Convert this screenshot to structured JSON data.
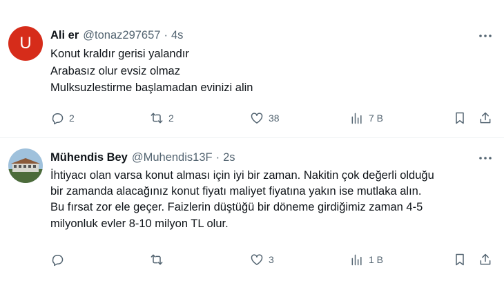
{
  "tweets": [
    {
      "author_name": "Ali er",
      "handle": "@tonaz297657",
      "separator": "·",
      "time": "4s",
      "avatar_letter": "U",
      "avatar_color": "#d62c1a",
      "text": "Konut kraldır gerisi yalandır\nArabasız olur evsiz olmaz\nMulksuzlestirme başlamadan evinizi alin",
      "replies": "2",
      "retweets": "2",
      "likes": "38",
      "views": "7 B"
    },
    {
      "author_name": "Mühendis Bey",
      "handle": "@Muhendis13F",
      "separator": "·",
      "time": "2s",
      "text": "İhtiyacı olan varsa konut alması için iyi bir zaman. Nakitin çok değerli olduğu\nbir zamanda alacağınız konut fiyatı maliyet fiyatına yakın ise mutlaka alın.\nBu fırsat zor ele geçer. Faizlerin düştüğü bir döneme girdiğimiz zaman 4-5\nmilyonluk evler 8-10 milyon TL olur.",
      "replies": "",
      "retweets": "",
      "likes": "3",
      "views": "1 B"
    }
  ],
  "icons": [
    "reply-icon",
    "retweet-icon",
    "like-icon",
    "views-icon",
    "bookmark-icon",
    "share-icon",
    "more-icon"
  ],
  "colors": {
    "text": "#0f1419",
    "secondary": "#536471",
    "divider": "#eff3f4"
  }
}
